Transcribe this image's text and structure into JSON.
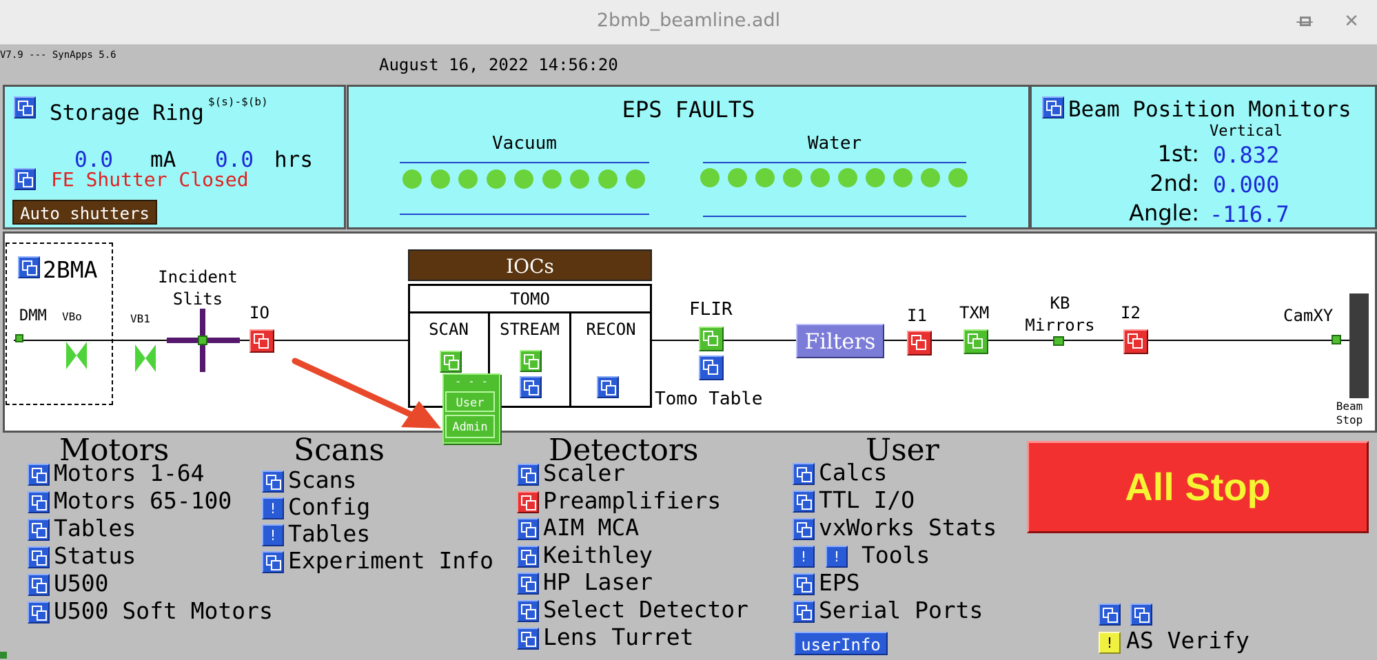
{
  "window": {
    "title": "2bmb_beamline.adl",
    "min": "—",
    "max": "□",
    "close": "✕"
  },
  "version": "V7.9 --- SynApps 5.6",
  "datetime": "August 16, 2022 14:56:20",
  "storage_ring": {
    "title": "Storage Ring",
    "macro": "$(s)-$(b)",
    "current": "0.0",
    "current_unit": "mA",
    "lifetime": "0.0",
    "lifetime_unit": "hrs",
    "shutter_status": "FE Shutter Closed",
    "auto_shutters": "Auto shutters"
  },
  "eps": {
    "title": "EPS FAULTS",
    "vacuum": "Vacuum",
    "water": "Water",
    "vacuum_leds": 9,
    "water_leds": 10
  },
  "bpm": {
    "title": "Beam Position Monitors",
    "subtitle": "Vertical",
    "rows": [
      {
        "label": "1st:",
        "value": "0.832"
      },
      {
        "label": "2nd:",
        "value": "0.000"
      },
      {
        "label": "Angle:",
        "value": "-116.7"
      }
    ]
  },
  "beamline": {
    "station": "2BMA",
    "dmm": "DMM",
    "vb0": "VBo",
    "vb1": "VB1",
    "incident_slits": [
      "Incident",
      "Slits"
    ],
    "i0": "IO",
    "iocs": "IOCs",
    "tomo": "TOMO",
    "scan": "SCAN",
    "stream": "STREAM",
    "recon": "RECON",
    "flir": "FLIR",
    "tomo_table": "Tomo Table",
    "filters": "Filters",
    "i1": "I1",
    "txm": "TXM",
    "kb_mirrors": [
      "KB",
      "Mirrors"
    ],
    "i2": "I2",
    "camxy": "CamXY",
    "beam_stop": [
      "Beam",
      "Stop"
    ],
    "popup": {
      "header": "- - -",
      "items": [
        "User",
        "Admin"
      ]
    }
  },
  "motors": {
    "title": "Motors",
    "items": [
      "Motors 1-64",
      "Motors 65-100",
      "Tables",
      "Status",
      "U500",
      "U500 Soft Motors"
    ]
  },
  "scans": {
    "title": "Scans",
    "items": [
      "Scans",
      "Config",
      "Tables",
      "Experiment Info"
    ]
  },
  "detectors": {
    "title": "Detectors",
    "items": [
      "Scaler",
      "Preamplifiers",
      "AIM MCA",
      "Keithley",
      "HP Laser",
      "Select Detector",
      "Lens Turret"
    ]
  },
  "user": {
    "title": "User",
    "items": [
      "Calcs",
      "TTL I/O",
      "vxWorks Stats",
      "Tools",
      "EPS",
      "Serial Ports"
    ],
    "userinfo": "userInfo"
  },
  "all_stop": "All Stop",
  "as_verify": "AS Verify",
  "colors": {
    "cyan_panel": "#9cf8f8",
    "all_stop_red": "#f23030",
    "all_stop_text": "#f5f534",
    "ioc_brown": "#5a3510",
    "ok_green": "#6ad23a"
  },
  "icons": [
    "related-display-icon",
    "shell-command-icon",
    "window-minimize-icon",
    "window-maximize-icon",
    "window-close-icon"
  ]
}
